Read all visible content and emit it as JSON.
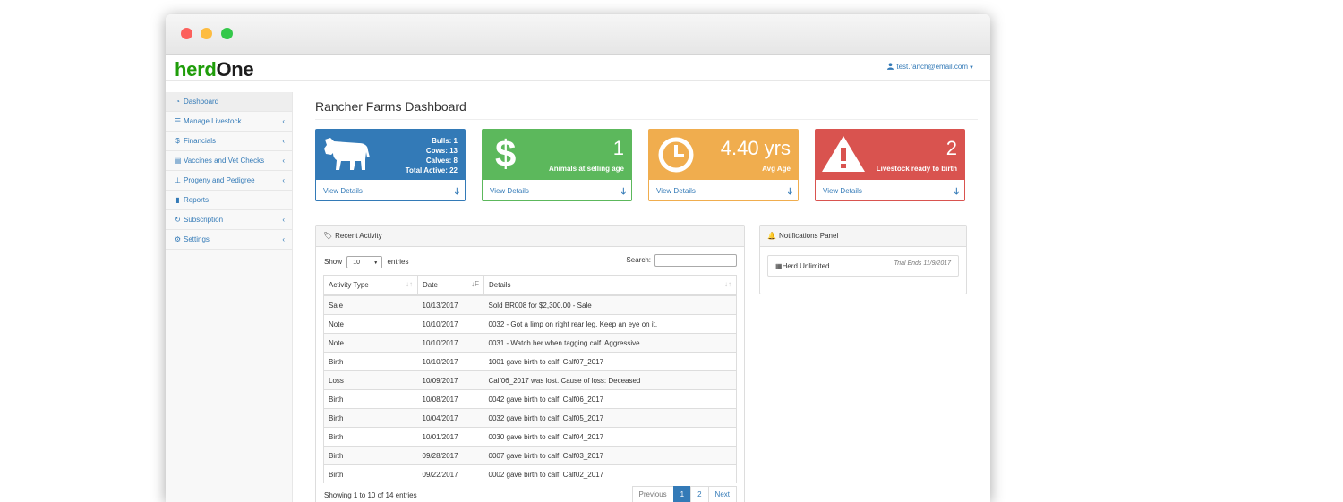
{
  "app": {
    "brand_part1": "herd",
    "brand_part2": "One",
    "user_email": "test.ranch@email.com"
  },
  "sidebar": {
    "items": [
      {
        "label": "Dashboard",
        "icon": "dashboard-icon"
      },
      {
        "label": "Manage Livestock",
        "icon": "list-icon"
      },
      {
        "label": "Financials",
        "icon": "dollar-icon"
      },
      {
        "label": "Vaccines and Vet Checks",
        "icon": "list-alt-icon"
      },
      {
        "label": "Progeny and Pedigree",
        "icon": "sitemap-icon"
      },
      {
        "label": "Reports",
        "icon": "bar-chart-icon"
      },
      {
        "label": "Subscription",
        "icon": "refresh-icon"
      },
      {
        "label": "Settings",
        "icon": "gear-icon"
      }
    ]
  },
  "page": {
    "title": "Rancher Farms Dashboard"
  },
  "cards": {
    "livestock": {
      "bulls": "Bulls: 1",
      "cows": "Cows: 13",
      "calves": "Calves: 8",
      "total": "Total Active: 22",
      "footer": "View Details",
      "color": "#337ab7"
    },
    "selling": {
      "value": "1",
      "label": "Animals at selling age",
      "footer": "View Details",
      "color": "#5cb85c"
    },
    "age": {
      "value": "4.40 yrs",
      "label": "Avg Age",
      "footer": "View Details",
      "color": "#f0ad4e"
    },
    "birth": {
      "value": "2",
      "label": "Livestock ready to birth",
      "footer": "View Details",
      "color": "#d9534f"
    }
  },
  "activity": {
    "title": "Recent Activity",
    "show_label": "Show",
    "entries_value": "10",
    "entries_label": "entries",
    "search_label": "Search:",
    "columns": [
      "Activity Type",
      "Date",
      "Details"
    ],
    "rows": [
      [
        "Sale",
        "10/13/2017",
        "Sold BR008 for $2,300.00 - Sale"
      ],
      [
        "Note",
        "10/10/2017",
        "0032 - Got a limp on right rear leg. Keep an eye on it."
      ],
      [
        "Note",
        "10/10/2017",
        "0031 - Watch her when tagging calf. Aggressive."
      ],
      [
        "Birth",
        "10/10/2017",
        "1001 gave birth to calf: Calf07_2017"
      ],
      [
        "Loss",
        "10/09/2017",
        "Calf06_2017 was lost. Cause of loss: Deceased"
      ],
      [
        "Birth",
        "10/08/2017",
        "0042 gave birth to calf: Calf06_2017"
      ],
      [
        "Birth",
        "10/04/2017",
        "0032 gave birth to calf: Calf05_2017"
      ],
      [
        "Birth",
        "10/01/2017",
        "0030 gave birth to calf: Calf04_2017"
      ],
      [
        "Birth",
        "09/28/2017",
        "0007 gave birth to calf: Calf03_2017"
      ],
      [
        "Birth",
        "09/22/2017",
        "0002 gave birth to calf: Calf02_2017"
      ]
    ],
    "info": "Showing 1 to 10 of 14 entries",
    "pagination": {
      "previous": "Previous",
      "pages": [
        "1",
        "2"
      ],
      "next": "Next",
      "active_page": "1"
    }
  },
  "notifications": {
    "title": "Notifications Panel",
    "item_label": "Herd Unlimited",
    "item_meta": "Trial Ends 11/9/2017"
  }
}
